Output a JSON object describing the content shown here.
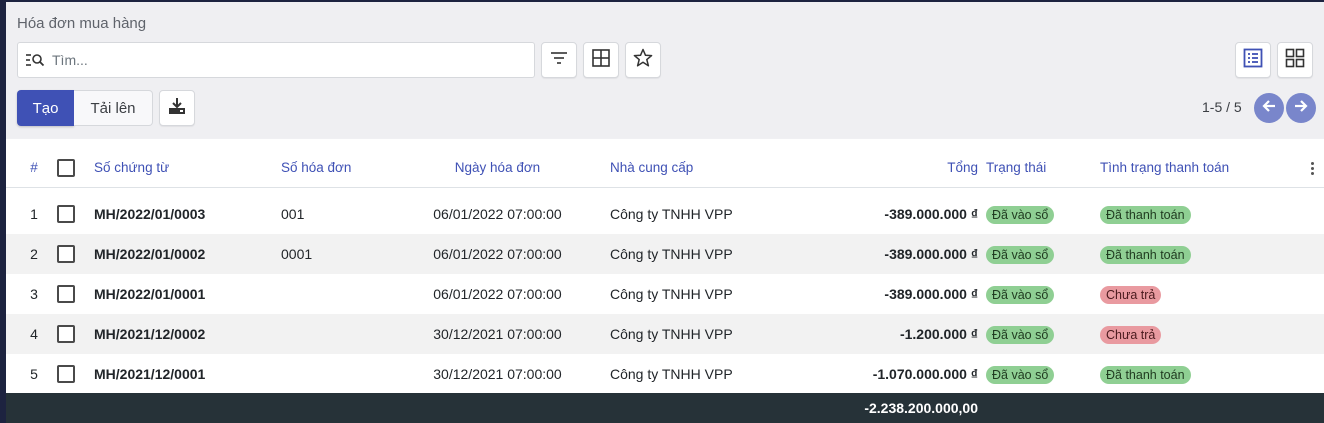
{
  "breadcrumb": "Hóa đơn mua hàng",
  "search": {
    "placeholder": "Tìm..."
  },
  "icons": {
    "search": "search-list-icon",
    "filter": "filter-icon",
    "group_by": "grid-table-icon",
    "favorite": "star-icon",
    "list_view": "list-view-icon",
    "kanban_view": "kanban-view-icon",
    "download": "download-icon",
    "prev": "arrow-left-icon",
    "next": "arrow-right-icon",
    "more": "vertical-dots-icon"
  },
  "toolbar": {
    "create_label": "Tạo",
    "upload_label": "Tải lên"
  },
  "pager": {
    "value": "1-5 / 5"
  },
  "table": {
    "headers": {
      "num": "#",
      "doc": "Số chứng từ",
      "invoice": "Số hóa đơn",
      "date": "Ngày hóa đơn",
      "vendor": "Nhà cung cấp",
      "total": "Tổng",
      "state": "Trạng thái",
      "payment": "Tình trạng thanh toán"
    },
    "rows": [
      {
        "num": "1",
        "doc": "MH/2022/01/0003",
        "invoice": "001",
        "date": "06/01/2022 07:00:00",
        "vendor": "Công ty TNHH VPP",
        "total": "-389.000.000 ₫",
        "state": "Đã vào sổ",
        "payment": "Đã thanh toán"
      },
      {
        "num": "2",
        "doc": "MH/2022/01/0002",
        "invoice": "0001",
        "date": "06/01/2022 07:00:00",
        "vendor": "Công ty TNHH VPP",
        "total": "-389.000.000 ₫",
        "state": "Đã vào sổ",
        "payment": "Đã thanh toán"
      },
      {
        "num": "3",
        "doc": "MH/2022/01/0001",
        "invoice": "",
        "date": "06/01/2022 07:00:00",
        "vendor": "Công ty TNHH VPP",
        "total": "-389.000.000 ₫",
        "state": "Đã vào sổ",
        "payment": "Chưa trả"
      },
      {
        "num": "4",
        "doc": "MH/2021/12/0002",
        "invoice": "",
        "date": "30/12/2021 07:00:00",
        "vendor": "Công ty TNHH VPP",
        "total": "-1.200.000 ₫",
        "state": "Đã vào sổ",
        "payment": "Chưa trả"
      },
      {
        "num": "5",
        "doc": "MH/2021/12/0001",
        "invoice": "",
        "date": "30/12/2021 07:00:00",
        "vendor": "Công ty TNHH VPP",
        "total": "-1.070.000.000 ₫",
        "state": "Đã vào sổ",
        "payment": "Đã thanh toán"
      }
    ],
    "footer_total": "-2.238.200.000,00"
  },
  "colors": {
    "primary": "#3f51b5",
    "badge_posted": "#8fcf93",
    "badge_paid": "#8fcf93",
    "badge_unpaid": "#e99aa0",
    "footer": "#263238"
  }
}
